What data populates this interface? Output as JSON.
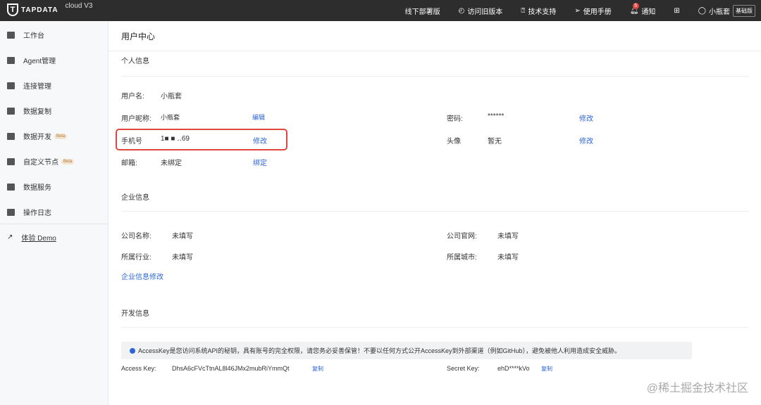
{
  "header": {
    "brand": "TAPDATA",
    "version": "cloud V3",
    "nav": [
      "线下部署版",
      "访问旧版本",
      "技术支持",
      "使用手册"
    ],
    "notice_label": "通知",
    "notice_count": "5",
    "user": "小瓶套",
    "plan": "基础版"
  },
  "sidebar": {
    "items": [
      {
        "label": "工作台"
      },
      {
        "label": "Agent管理"
      },
      {
        "label": "连接管理"
      },
      {
        "label": "数据复制"
      },
      {
        "label": "数据开发",
        "badge": "Beta"
      },
      {
        "label": "自定义节点",
        "badge": "Beta"
      },
      {
        "label": "数据服务"
      },
      {
        "label": "操作日志"
      }
    ],
    "demo": "体验 Demo"
  },
  "page": {
    "title": "用户中心"
  },
  "personal": {
    "title": "个人信息",
    "username_label": "用户名:",
    "username": "小瓶套",
    "nickname_label": "用户昵称:",
    "nickname": "小瓶套",
    "edit": "编辑",
    "phone_label": "手机号",
    "phone": "1■  ■  ‥69",
    "modify": "修改",
    "email_label": "邮箱:",
    "email": "未绑定",
    "bind": "绑定",
    "password_label": "密码:",
    "password": "******",
    "avatar_label": "头像",
    "avatar": "暂无"
  },
  "company": {
    "title": "企业信息",
    "name_label": "公司名称:",
    "name": "未填写",
    "site_label": "公司官网:",
    "site": "未填写",
    "industry_label": "所属行业:",
    "industry": "未填写",
    "city_label": "所属城市:",
    "city": "未填写",
    "edit": "企业信息修改"
  },
  "dev": {
    "title": "开发信息",
    "alert": "AccessKey是您访问系统API的秘钥，具有账号的完全权限，请您务必妥善保管！不要以任何方式公开AccessKey到外部渠道（例如GitHub），避免被他人利用造成安全威胁。",
    "access_label": "Access Key:",
    "access": "DhsA6cFVcTtnAL8l46JMx2mubRiYmmQt",
    "secret_label": "Secret Key:",
    "secret": "ehD****kVo",
    "copy": "复制"
  },
  "watermark": "@稀土掘金技术社区"
}
